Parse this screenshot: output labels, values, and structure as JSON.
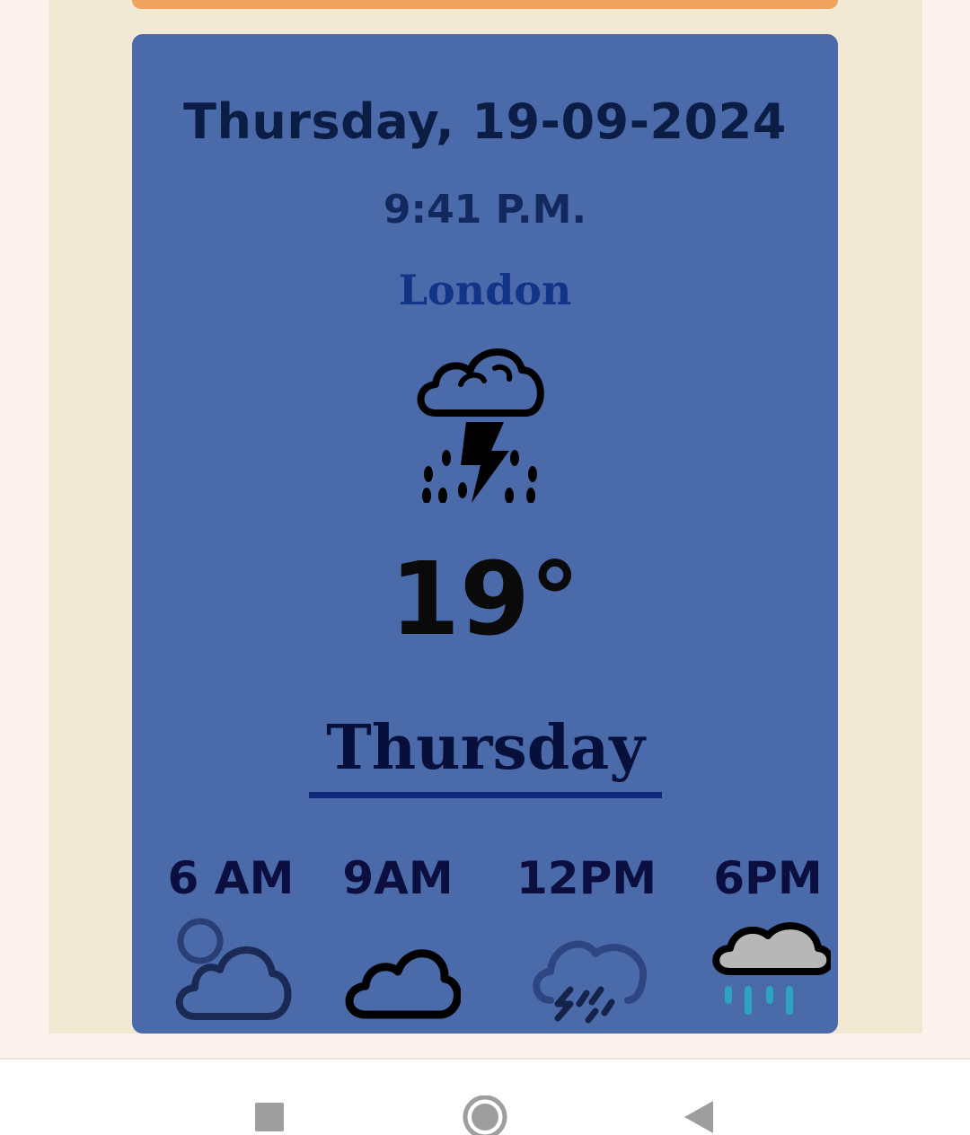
{
  "header": {
    "date": "Thursday, 19-09-2024",
    "time": "9:41 P.M.",
    "city": "London"
  },
  "current": {
    "icon": "thunderstorm-rain-icon",
    "temperature": "19°"
  },
  "forecast": {
    "day": "Thursday",
    "hours": [
      {
        "label": "6 AM",
        "icon": "cloudy-night-icon"
      },
      {
        "label": "9AM",
        "icon": "cloud-icon"
      },
      {
        "label": "12PM",
        "icon": "thunder-showers-icon"
      },
      {
        "label": "6PM",
        "icon": "rain-cloud-icon"
      }
    ]
  },
  "colors": {
    "card": "#4b6aaa",
    "panel": "#f2e9d5",
    "top_bar": "#eea25c",
    "accent": "#0f2a7c"
  },
  "system_nav": {
    "icons": [
      "recent-apps-icon",
      "home-icon",
      "back-icon"
    ]
  }
}
